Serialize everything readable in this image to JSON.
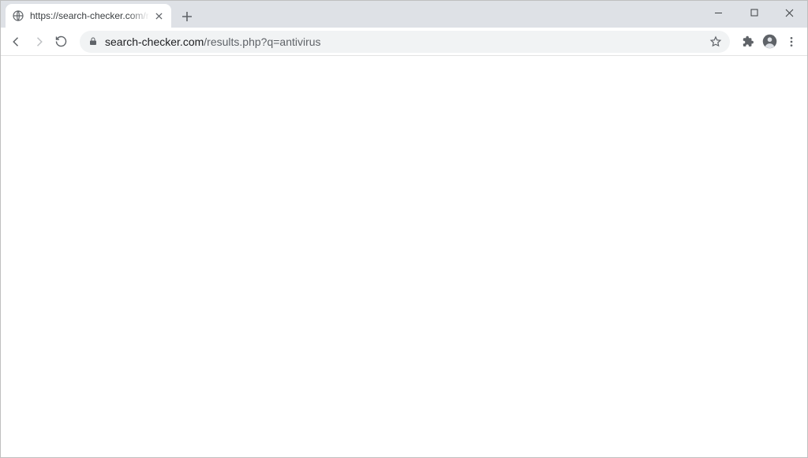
{
  "window": {
    "minimize_label": "Minimize",
    "maximize_label": "Maximize",
    "close_label": "Close"
  },
  "tab": {
    "title": "https://search-checker.com/results.php?q=antivirus",
    "close_label": "Close tab"
  },
  "toolbar": {
    "new_tab_label": "New tab",
    "back_label": "Back",
    "forward_label": "Forward",
    "reload_label": "Reload",
    "url_host": "search-checker.com",
    "url_path": "/results.php?q=antivirus",
    "star_label": "Bookmark",
    "extensions_label": "Extensions",
    "profile_label": "Profile",
    "menu_label": "Menu"
  }
}
